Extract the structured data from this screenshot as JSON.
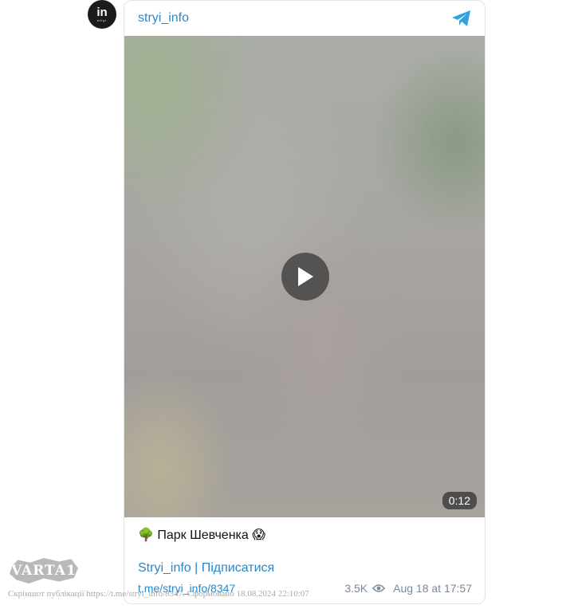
{
  "channel": {
    "avatar_text": "in",
    "avatar_subtext": "stryi",
    "name": "stryi_info",
    "telegram_icon": "telegram-icon"
  },
  "video": {
    "duration": "0:12",
    "play_icon": "play-icon"
  },
  "post": {
    "caption": "🌳 Парк Шевченка 😱",
    "channel_link": "Stryi_info",
    "separator": " | ",
    "subscribe_link": "Підписатися",
    "post_link": "t.me/stryi_info/8347",
    "views": "3.5K",
    "date": "Aug 18 at 17:57"
  },
  "watermark": {
    "logo_text": "VARTA1",
    "text": "Скріншот публікації https://t.me/stryi_info/8347. Сформовано 18.08.2024 22:10:07"
  },
  "colors": {
    "link": "#2b87c4",
    "meta": "#7a8a99",
    "border": "#dfe3e8"
  }
}
